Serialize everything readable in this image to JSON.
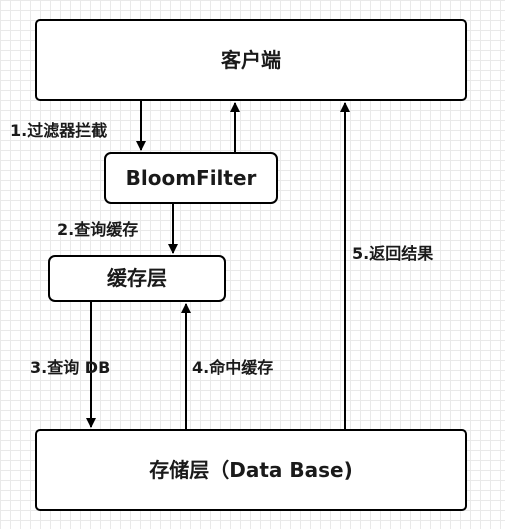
{
  "nodes": {
    "client": "客户端",
    "bloom_filter": "BloomFilter",
    "cache_layer": "缓存层",
    "storage_layer": "存储层（Data Base)"
  },
  "edges": {
    "step1": "1.过滤器拦截",
    "step2": "2.查询缓存",
    "step3": "3.查询 DB",
    "step4": "4.命中缓存",
    "step5": "5.返回结果"
  },
  "colors": {
    "stroke": "#000000",
    "text": "#1a1a1a",
    "background": "#ffffff",
    "grid": "#e9e9e9"
  }
}
